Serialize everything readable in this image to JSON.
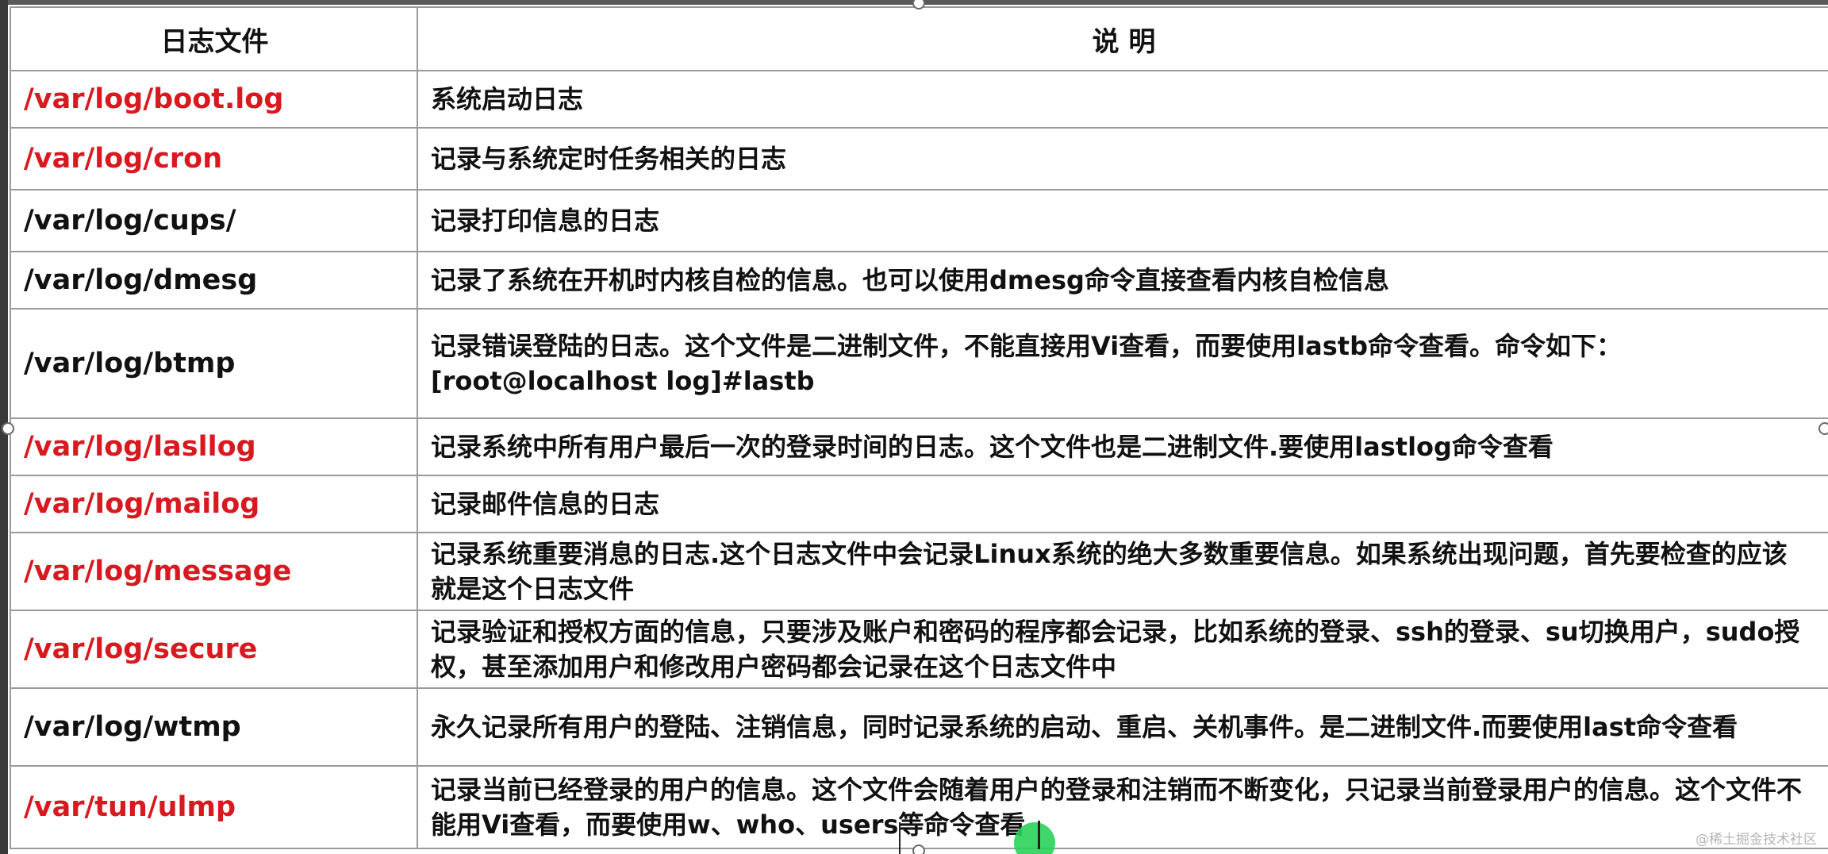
{
  "table": {
    "headers": [
      "日志文件",
      "说 明"
    ],
    "rows": [
      {
        "path": "/var/log/boot.log",
        "desc": "系统启动日志",
        "color": "#d8191f"
      },
      {
        "path": "/var/log/cron",
        "desc": "记录与系统定时任务相关的日志",
        "color": "#d8191f"
      },
      {
        "path": "/var/log/cups/",
        "desc": "记录打印信息的日志",
        "color": "#111111"
      },
      {
        "path": "/var/log/dmesg",
        "desc": "记录了系统在开机时内核自检的信息。也可以使用dmesg命令直接查看内核自检信息",
        "color": "#111111"
      },
      {
        "path": "/var/log/btmp",
        "desc": "记录错误登陆的日志。这个文件是二进制文件，不能直接用Vi查看，而要使用lastb命令查看。命令如下：[root@localhost log]#lastb",
        "color": "#111111"
      },
      {
        "path": "/var/log/lasllog",
        "desc": "记录系统中所有用户最后一次的登录时间的日志。这个文件也是二进制文件.要使用lastlog命令查看",
        "color": "#d8191f"
      },
      {
        "path": "/var/Iog/mailog",
        "desc": "记录邮件信息的日志",
        "color": "#d8191f"
      },
      {
        "path": "/var/log/message",
        "desc": "记录系统重要消息的日志.这个日志文件中会记录Linux系统的绝大多数重要信息。如果系统出现问题，首先要检查的应该就是这个日志文件",
        "color": "#d8191f"
      },
      {
        "path": "/var/log/secure",
        "desc": "记录验证和授权方面的信息，只要涉及账户和密码的程序都会记录，比如系统的登录、ssh的登录、su切换用户，sudo授权，甚至添加用户和修改用户密码都会记录在这个日志文件中",
        "color": "#d8191f"
      },
      {
        "path": "/var/log/wtmp",
        "desc": "永久记录所有用户的登陆、注销信息，同时记录系统的启动、重启、关机事件。是二进制文件.而要使用last命令查看",
        "color": "#111111"
      },
      {
        "path": "/var/tun/ulmp",
        "desc": "记录当前已经登录的用户的信息。这个文件会随着用户的登录和注销而不断变化，只记录当前登录用户的信息。这个文件不能用Vi查看，而要使用w、who、users等命令查看",
        "color": "#d8191f"
      }
    ]
  },
  "watermark": "@稀土掘金技术社区"
}
